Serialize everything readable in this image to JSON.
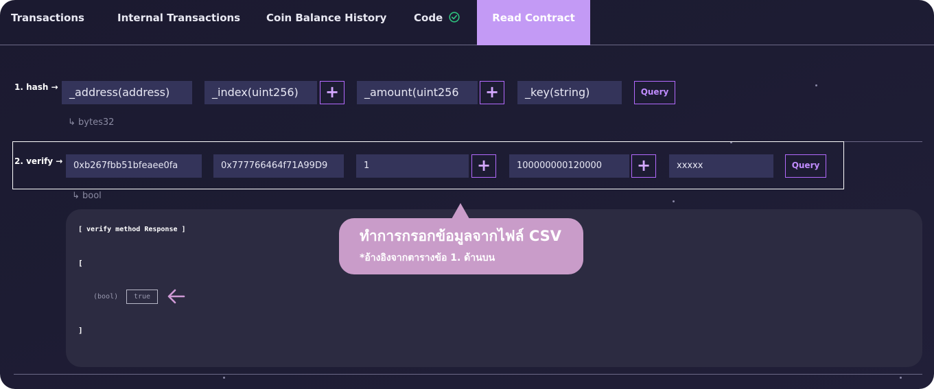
{
  "tabs": [
    {
      "label": "Transactions"
    },
    {
      "label": "Internal Transactions"
    },
    {
      "label": "Coin Balance History"
    },
    {
      "label": "Code"
    },
    {
      "label": "Read Contract"
    }
  ],
  "hash_row": {
    "label": "1. hash →",
    "inputs": [
      "_address(address)",
      "_index(uint256)",
      "_amount(uint256",
      "_key(string)"
    ],
    "plus": "+",
    "query_label": "Query",
    "return_type": "↳ bytes32"
  },
  "verify_row": {
    "label": "2. verify →",
    "inputs": [
      "0xb267fbb51bfeaee0fa",
      "0x777766464f71A99D9",
      "1",
      "100000000120000",
      "xxxxx"
    ],
    "plus": "+",
    "query_label": "Query",
    "return_type": "↳ bool"
  },
  "response": {
    "title": "[ verify method Response ]",
    "open_bracket": "[",
    "type_label": "(bool)",
    "value": "true",
    "close_bracket": "]"
  },
  "callout": {
    "title": "ทำการกรอกข้อมูลจากไฟล์ CSV",
    "note": "*อ้างอิงจากตารางข้อ 1. ด้านบน"
  },
  "colors": {
    "background": "#1d1c33",
    "active_tab": "#c39af5",
    "accent": "#b46aff",
    "callout": "#c99cc9"
  },
  "icons": {
    "code_status": "check-circle-icon",
    "response_pointer": "arrow-left-icon"
  }
}
